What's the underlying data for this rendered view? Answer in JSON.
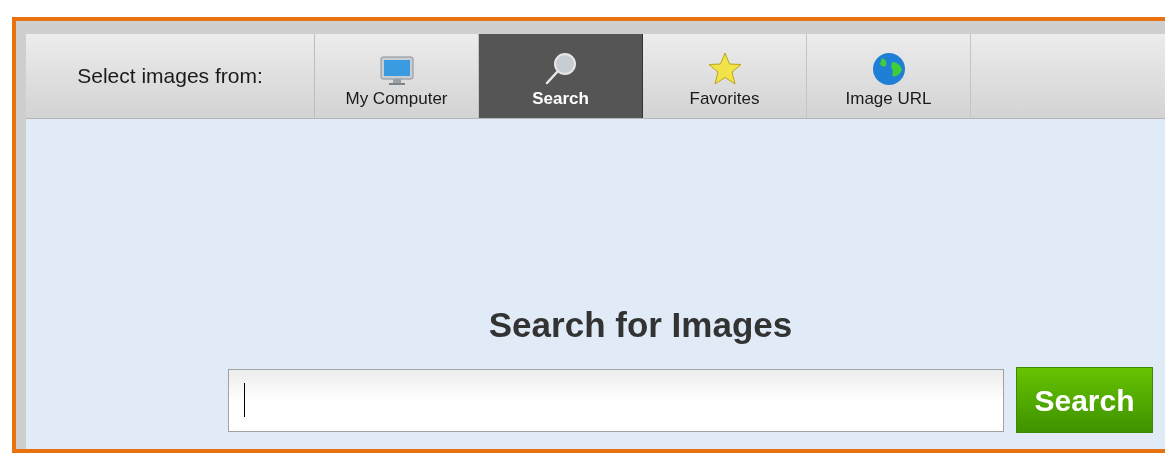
{
  "toolbar": {
    "label": "Select images from:",
    "tabs": [
      {
        "label": "My Computer",
        "selected": false
      },
      {
        "label": "Search",
        "selected": true
      },
      {
        "label": "Favorites",
        "selected": false
      },
      {
        "label": "Image URL",
        "selected": false
      }
    ]
  },
  "search": {
    "heading": "Search for Images",
    "button": "Search"
  }
}
